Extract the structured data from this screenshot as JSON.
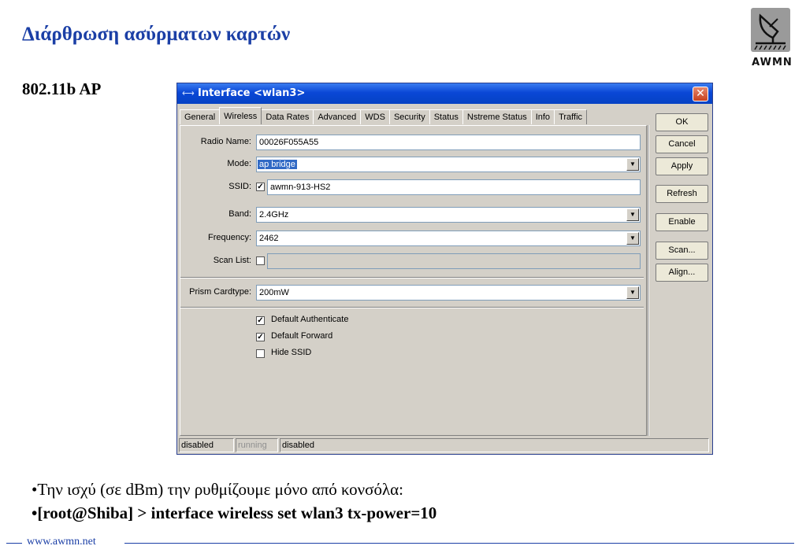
{
  "slide": {
    "title": "Διάρθρωση ασύρματων καρτών",
    "subheading": "802.11b AP",
    "logo_text": "AWMN",
    "bullets": [
      "•Την ισχύ (σε dBm) την ρυθμίζουμε μόνο από κονσόλα:",
      "•[root@Shiba] > interface wireless set wlan3 tx-power=10"
    ],
    "footer_url": "www.awmn.net"
  },
  "window": {
    "title_icon": "⟷",
    "title": "Interface <wlan3>",
    "close_label": "✕",
    "tabs": [
      "General",
      "Wireless",
      "Data Rates",
      "Advanced",
      "WDS",
      "Security",
      "Status",
      "Nstreme Status",
      "Info",
      "Traffic"
    ],
    "active_tab": "Wireless",
    "fields": {
      "radio_name": {
        "label": "Radio Name:",
        "value": "00026F055A55"
      },
      "mode": {
        "label": "Mode:",
        "value": "ap bridge"
      },
      "ssid": {
        "label": "SSID:",
        "value": "awmn-913-HS2",
        "checked": true
      },
      "band": {
        "label": "Band:",
        "value": "2.4GHz"
      },
      "frequency": {
        "label": "Frequency:",
        "value": "2462"
      },
      "scan_list": {
        "label": "Scan List:",
        "value": "",
        "checked": false
      },
      "prism_cardtype": {
        "label": "Prism Cardtype:",
        "value": "200mW"
      }
    },
    "checkboxes": [
      {
        "label": "Default Authenticate",
        "checked": true
      },
      {
        "label": "Default Forward",
        "checked": true
      },
      {
        "label": "Hide SSID",
        "checked": false
      }
    ],
    "buttons": {
      "ok": "OK",
      "cancel": "Cancel",
      "apply": "Apply",
      "refresh": "Refresh",
      "enable": "Enable",
      "scan": "Scan...",
      "align": "Align..."
    },
    "status": [
      "disabled",
      "running",
      "disabled"
    ]
  },
  "colors": {
    "title_blue": "#1b3fa6",
    "titlebar_blue": "#0a47d6",
    "selection": "#316ac5"
  }
}
